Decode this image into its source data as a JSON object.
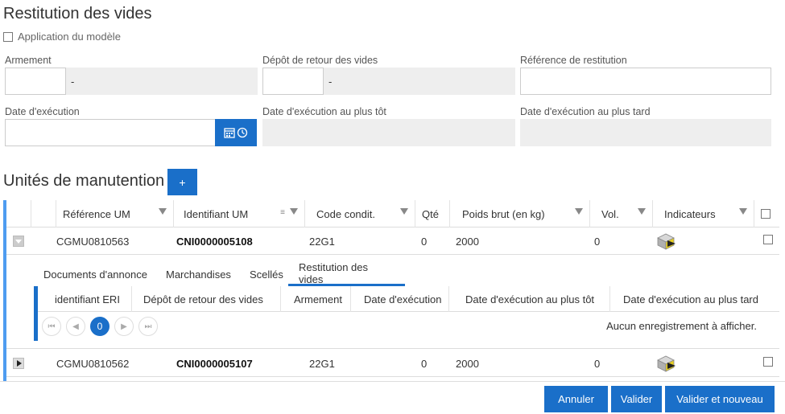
{
  "page_title": "Restitution des vides",
  "template_label": "Application du modèle",
  "fields": {
    "armement_label": "Armement",
    "armement_suffix": "-",
    "depot_label": "Dépôt de retour des vides",
    "depot_suffix": "-",
    "reference_label": "Référence de restitution",
    "date_label": "Date d'exécution",
    "date_earliest_label": "Date d'exécution au plus tôt",
    "date_latest_label": "Date d'exécution au plus tard"
  },
  "section_title": "Unités de manutention",
  "add_label": "+",
  "grid": {
    "columns": [
      "Référence UM",
      "Identifiant UM",
      "Code condit.",
      "Qté",
      "Poids brut (en kg)",
      "Vol.",
      "Indicateurs"
    ],
    "rows": [
      {
        "reference": "CGMU0810563",
        "identifiant": "CNI0000005108",
        "code": "22G1",
        "qte": "0",
        "poids": "2000",
        "vol": "0",
        "expanded": true
      },
      {
        "reference": "CGMU0810562",
        "identifiant": "CNI0000005107",
        "code": "22G1",
        "qte": "0",
        "poids": "2000",
        "vol": "0",
        "expanded": false
      }
    ]
  },
  "detail": {
    "tabs": [
      "Documents d'annonce",
      "Marchandises",
      "Scellés",
      "Restitution des vides"
    ],
    "active_tab": "Restitution des vides",
    "sub_columns": [
      "identifiant ERI",
      "Dépôt de retour des vides",
      "Armement",
      "Date d'exécution",
      "Date d'exécution au plus tôt",
      "Date d'exécution au plus tard"
    ],
    "current_page": "0",
    "empty_message": "Aucun enregistrement à afficher."
  },
  "buttons": {
    "cancel": "Annuler",
    "validate": "Valider",
    "validate_new": "Valider et nouveau"
  },
  "colors": {
    "accent": "#1a6fc9",
    "grid_bar": "#4e9cf0"
  }
}
